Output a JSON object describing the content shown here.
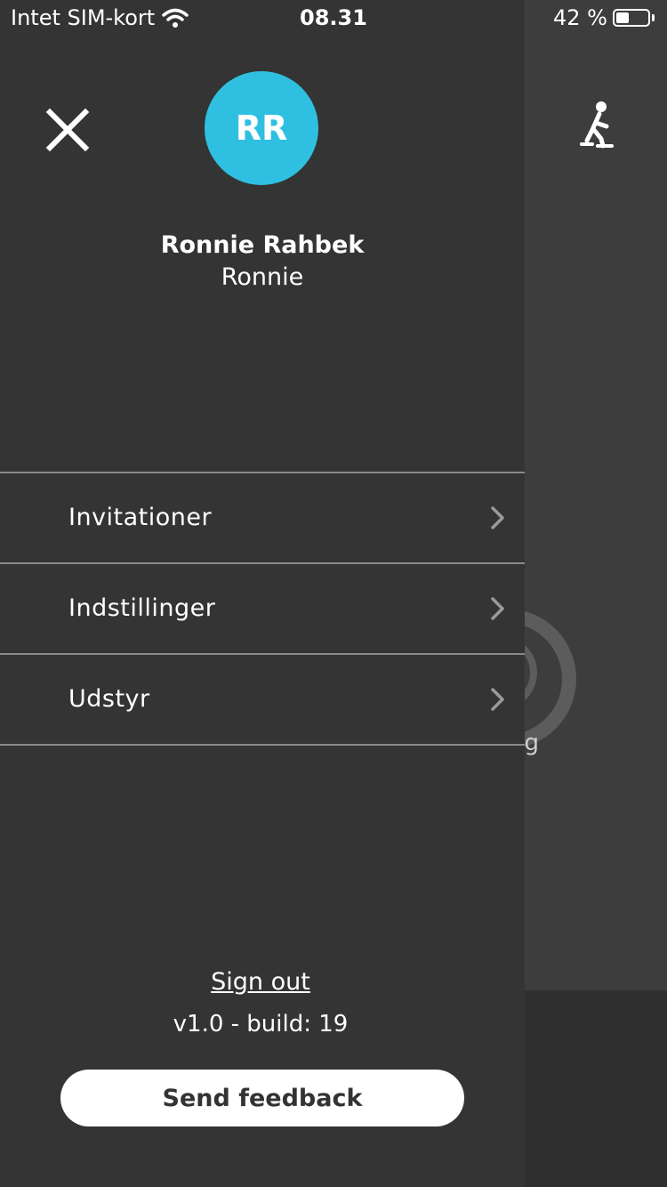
{
  "status_bar": {
    "carrier": "Intet SIM-kort",
    "time": "08.31",
    "battery_percent": "42 %",
    "battery_level": 0.42
  },
  "drawer": {
    "close_icon": "close-icon",
    "avatar_initials": "RR",
    "avatar_color": "#2fc0e1",
    "user_name": "Ronnie Rahbek",
    "username": "Ronnie",
    "menu": [
      {
        "label": "Invitationer",
        "icon": "chevron-right-icon"
      },
      {
        "label": "Indstillinger",
        "icon": "chevron-right-icon"
      },
      {
        "label": "Udstyr",
        "icon": "chevron-right-icon"
      }
    ],
    "sign_out_label": "Sign out",
    "version": "v1.0 - build: 19",
    "feedback_label": "Send feedback"
  },
  "background": {
    "activity_icon": "walking-person-icon",
    "partial_label": "g"
  }
}
